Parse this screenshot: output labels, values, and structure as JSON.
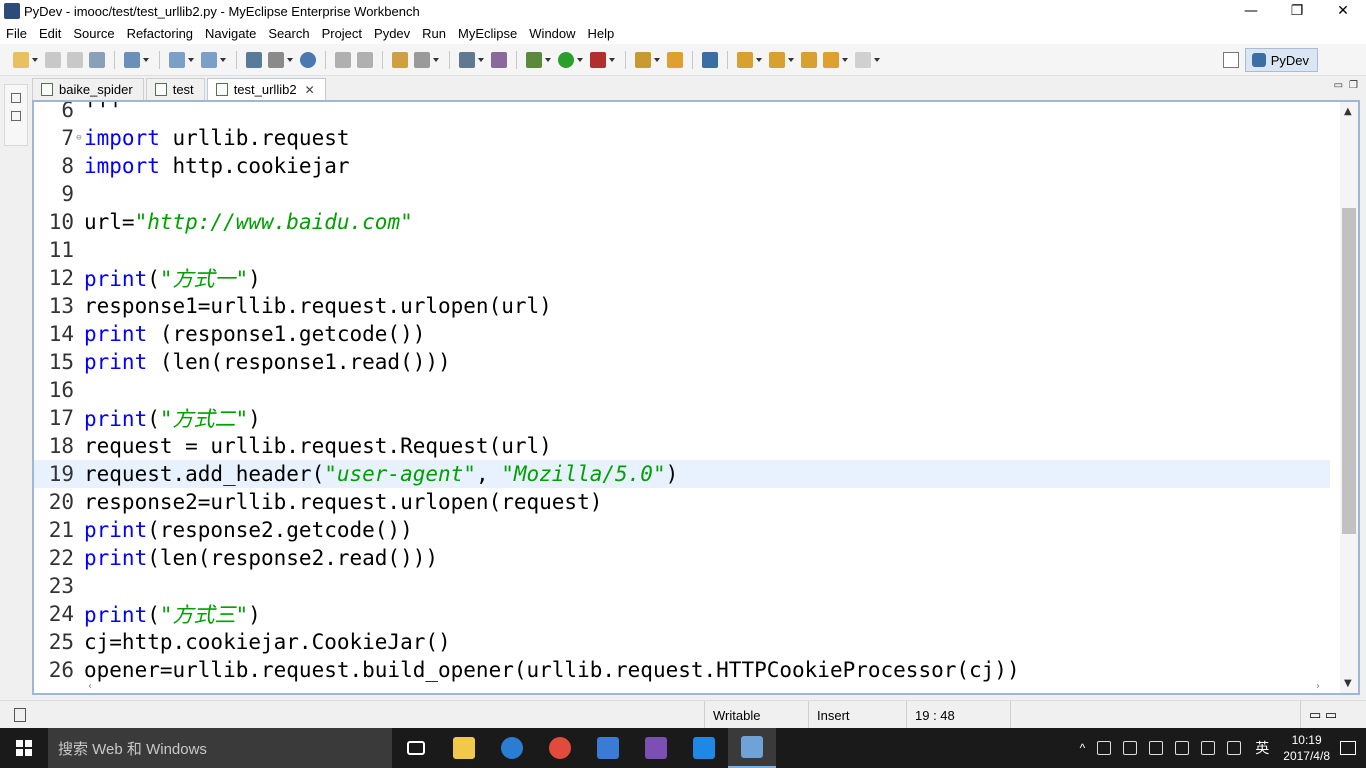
{
  "window": {
    "title": "PyDev - imooc/test/test_urllib2.py - MyEclipse Enterprise Workbench",
    "controls": [
      "—",
      "❐",
      "✕"
    ]
  },
  "menu": [
    "File",
    "Edit",
    "Source",
    "Refactoring",
    "Navigate",
    "Search",
    "Project",
    "Pydev",
    "Run",
    "MyEclipse",
    "Window",
    "Help"
  ],
  "perspective": {
    "label": "PyDev"
  },
  "tabs": [
    {
      "label": "baike_spider",
      "active": false
    },
    {
      "label": "test",
      "active": false
    },
    {
      "label": "test_urllib2",
      "active": true,
      "close": "✕"
    }
  ],
  "editor": {
    "current_line": 19,
    "lines": [
      {
        "num": "6",
        "tokens": [
          {
            "t": "'''",
            "c": "plain"
          }
        ]
      },
      {
        "num": "7",
        "fold": "⊖",
        "tokens": [
          {
            "t": "import",
            "c": "kw"
          },
          {
            "t": " urllib.request",
            "c": "plain"
          }
        ]
      },
      {
        "num": "8",
        "tokens": [
          {
            "t": "import",
            "c": "kw"
          },
          {
            "t": " http.cookiejar",
            "c": "plain"
          }
        ]
      },
      {
        "num": "9",
        "tokens": []
      },
      {
        "num": "10",
        "tokens": [
          {
            "t": "url=",
            "c": "plain"
          },
          {
            "t": "\"http://www.baidu.com\"",
            "c": "str"
          }
        ]
      },
      {
        "num": "11",
        "tokens": []
      },
      {
        "num": "12",
        "tokens": [
          {
            "t": "print",
            "c": "kw"
          },
          {
            "t": "(",
            "c": "plain"
          },
          {
            "t": "\"方式一\"",
            "c": "str"
          },
          {
            "t": ")",
            "c": "plain"
          }
        ]
      },
      {
        "num": "13",
        "tokens": [
          {
            "t": "response1=urllib.request.urlopen(url)",
            "c": "plain"
          }
        ]
      },
      {
        "num": "14",
        "tokens": [
          {
            "t": "print",
            "c": "kw"
          },
          {
            "t": " (response1.getcode())",
            "c": "plain"
          }
        ]
      },
      {
        "num": "15",
        "tokens": [
          {
            "t": "print",
            "c": "kw"
          },
          {
            "t": " (len(response1.read()))",
            "c": "plain"
          }
        ]
      },
      {
        "num": "16",
        "tokens": []
      },
      {
        "num": "17",
        "tokens": [
          {
            "t": "print",
            "c": "kw"
          },
          {
            "t": "(",
            "c": "plain"
          },
          {
            "t": "\"方式二\"",
            "c": "str"
          },
          {
            "t": ")",
            "c": "plain"
          }
        ]
      },
      {
        "num": "18",
        "tokens": [
          {
            "t": "request = urllib.request.Request(url)",
            "c": "plain"
          }
        ]
      },
      {
        "num": "19",
        "tokens": [
          {
            "t": "request.add_header(",
            "c": "plain"
          },
          {
            "t": "\"user-agent\"",
            "c": "str"
          },
          {
            "t": ", ",
            "c": "plain"
          },
          {
            "t": "\"Mozilla/5.0\"",
            "c": "str"
          },
          {
            "t": ")",
            "c": "plain"
          }
        ]
      },
      {
        "num": "20",
        "tokens": [
          {
            "t": "response2=urllib.request.urlopen(request)",
            "c": "plain"
          }
        ]
      },
      {
        "num": "21",
        "tokens": [
          {
            "t": "print",
            "c": "kw"
          },
          {
            "t": "(response2.getcode())",
            "c": "plain"
          }
        ]
      },
      {
        "num": "22",
        "tokens": [
          {
            "t": "print",
            "c": "kw"
          },
          {
            "t": "(len(response2.read()))",
            "c": "plain"
          }
        ]
      },
      {
        "num": "23",
        "tokens": []
      },
      {
        "num": "24",
        "tokens": [
          {
            "t": "print",
            "c": "kw"
          },
          {
            "t": "(",
            "c": "plain"
          },
          {
            "t": "\"方式三\"",
            "c": "str"
          },
          {
            "t": ")",
            "c": "plain"
          }
        ]
      },
      {
        "num": "25",
        "tokens": [
          {
            "t": "cj=http.cookiejar.CookieJar()",
            "c": "plain"
          }
        ]
      },
      {
        "num": "26",
        "tokens": [
          {
            "t": "opener=urllib.request.build_opener(urllib.request.HTTPCookieProcessor(cj))",
            "c": "plain"
          }
        ]
      }
    ]
  },
  "status": {
    "mode": "Writable",
    "insert": "Insert",
    "position": "19 : 48"
  },
  "taskbar": {
    "search_placeholder": "搜索 Web 和 Windows",
    "tray_ime": "英",
    "time": "10:19",
    "date": "2017/4/8",
    "apps": [
      {
        "name": "task-view-icon",
        "color": "#ffffff"
      },
      {
        "name": "file-explorer-icon",
        "color": "#f2c84b"
      },
      {
        "name": "edge-browser-icon",
        "color": "#2b7cd3"
      },
      {
        "name": "chrome-icon",
        "color": "#e24a3b"
      },
      {
        "name": "notes-app-icon",
        "color": "#3a7bd5"
      },
      {
        "name": "visual-studio-icon",
        "color": "#7b4fb3"
      },
      {
        "name": "settings-app-icon",
        "color": "#1e88e5"
      },
      {
        "name": "myeclipse-icon",
        "color": "#6fa3d8"
      }
    ]
  },
  "colors": {
    "keyword": "#0000ff",
    "string": "#00a000",
    "current_line": "#e8f2fe"
  }
}
